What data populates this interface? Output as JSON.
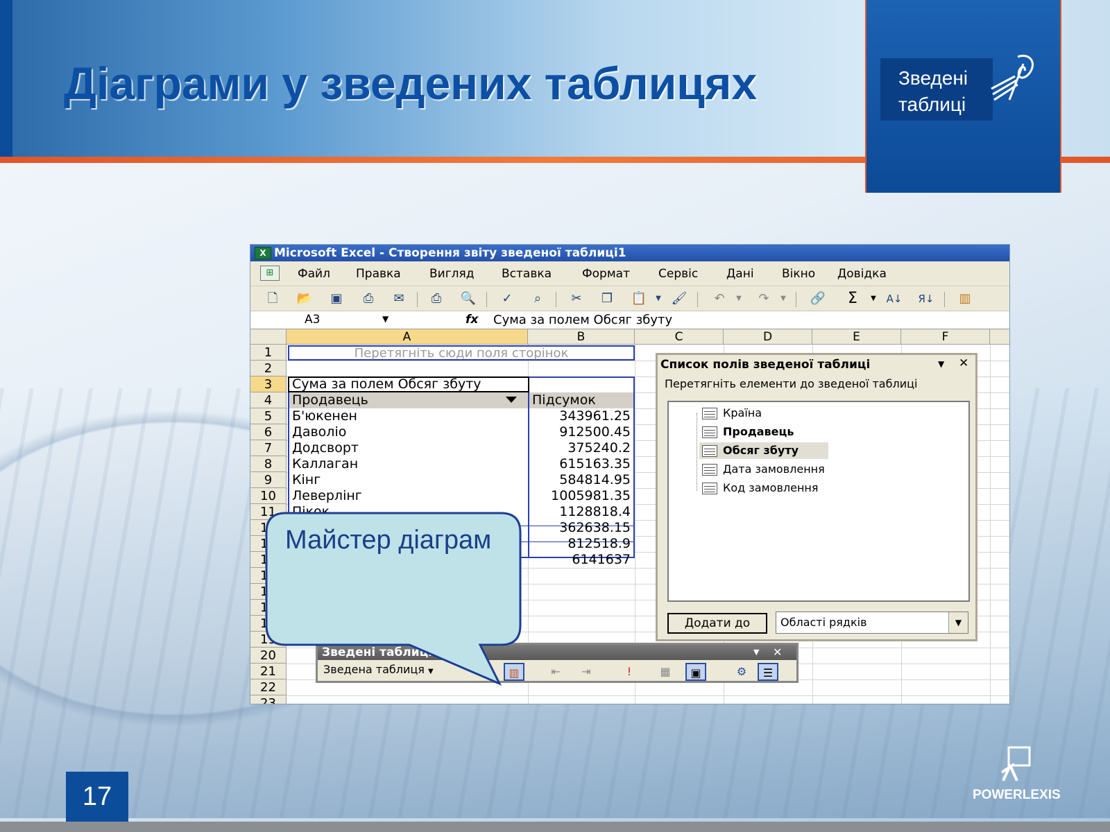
{
  "slide": {
    "title": "Діаграми у зведених таблицях",
    "badge_line1": "Зведені",
    "badge_line2": "таблиці",
    "page_number": "17",
    "footer_logo": "POWERLEXIS",
    "callout_text": "Майстер діаграм"
  },
  "excel": {
    "window_title": "Microsoft Excel - Створення звіту зведеної таблиці1",
    "menu": [
      "Файл",
      "Правка",
      "Вигляд",
      "Вставка",
      "Формат",
      "Сервіс",
      "Дані",
      "Вікно",
      "Довідка"
    ],
    "name_box": "A3",
    "fx_label": "fx",
    "formula": "Сума за полем Обсяг збуту",
    "columns": [
      "A",
      "B",
      "C",
      "D",
      "E",
      "F"
    ],
    "rows": [
      "1",
      "2",
      "3",
      "4",
      "5",
      "6",
      "7",
      "8",
      "9",
      "10",
      "11",
      "12",
      "13",
      "14",
      "15",
      "16",
      "17",
      "18",
      "19",
      "20",
      "21",
      "22",
      "23"
    ],
    "page_drop_hint": "Перетягніть сюди поля сторінок",
    "data_header": "Сума за полем Обсяг збуту",
    "row_field": "Продавець",
    "total_header": "Підсумок",
    "table_rows": [
      {
        "name": "Б'юкенен",
        "value": "343961.25"
      },
      {
        "name": "Даволіо",
        "value": "912500.45"
      },
      {
        "name": "Додсворт",
        "value": "375240.2"
      },
      {
        "name": "Каллаган",
        "value": "615163.35"
      },
      {
        "name": "Кінг",
        "value": "584814.95"
      },
      {
        "name": "Леверлінг",
        "value": "1005981.35"
      },
      {
        "name": "Пікок",
        "value": "1128818.4"
      },
      {
        "name": "",
        "value": "362638.15"
      },
      {
        "name": "",
        "value": "812518.9"
      },
      {
        "name": "",
        "value": "6141637"
      }
    ]
  },
  "field_list": {
    "title": "Список полів зведеної таблиці",
    "subtitle": "Перетягніть елементи до зведеної таблиці",
    "fields": [
      "Країна",
      "Продавець",
      "Обсяг збуту",
      "Дата замовлення",
      "Код замовлення"
    ],
    "add_button": "Додати до",
    "area_select": "Області рядків"
  },
  "pivot_toolbar": {
    "title": "Зведені таблиці",
    "dropdown": "Зведена таблиця"
  }
}
